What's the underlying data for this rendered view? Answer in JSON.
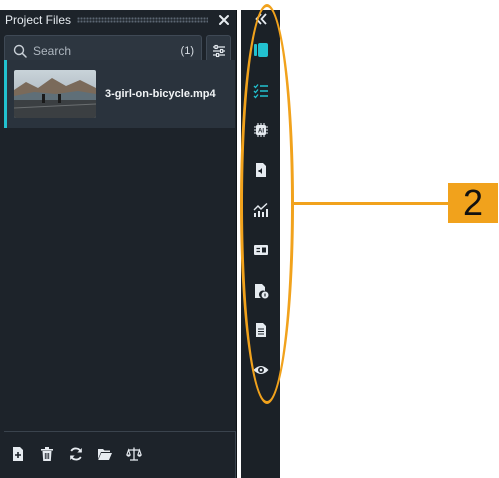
{
  "panel": {
    "title": "Project Files",
    "search": {
      "placeholder": "Search",
      "count": "(1)"
    },
    "files": [
      {
        "name": "3-girl-on-bicycle.mp4"
      }
    ]
  },
  "annotation": {
    "label": "2"
  },
  "colors": {
    "accent": "#22c1cf",
    "callout": "#f1a21c",
    "panel_bg": "#1d232a"
  },
  "rail_icons": [
    "media-panel-icon",
    "checklist-icon",
    "ai-chip-icon",
    "audio-file-icon",
    "chart-icon",
    "caption-icon",
    "file-info-icon",
    "document-icon",
    "eye-icon"
  ]
}
